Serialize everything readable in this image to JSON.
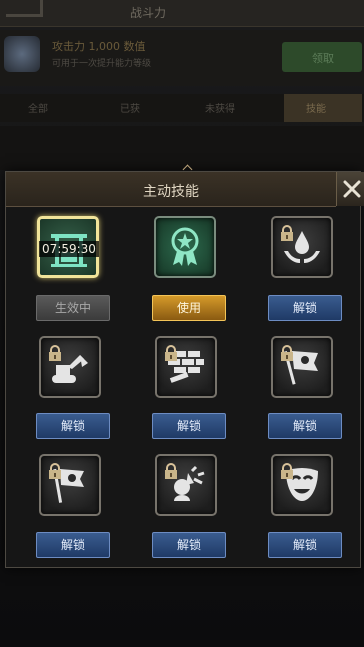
{
  "background": {
    "topbar_title": "战斗力",
    "item_title": "攻击力 1,000 数值",
    "item_sub": "可用于一次提升能力等级",
    "green_button": "领取",
    "tabs": [
      "全部",
      "已获",
      "未获得",
      "技能"
    ]
  },
  "dialog": {
    "title": "主动技能",
    "close": "close"
  },
  "skills": [
    {
      "icon": "harbor-crane-icon",
      "button": "生效中",
      "state": "active",
      "timer": "07:59:30"
    },
    {
      "icon": "award-ribbon-icon",
      "button": "使用",
      "state": "ready"
    },
    {
      "icon": "water-hands-icon",
      "button": "解锁",
      "state": "locked"
    },
    {
      "icon": "excavator-icon",
      "button": "解锁",
      "state": "locked"
    },
    {
      "icon": "brick-wall-icon",
      "button": "解锁",
      "state": "locked"
    },
    {
      "icon": "skull-flag-icon",
      "button": "解锁",
      "state": "locked"
    },
    {
      "icon": "bomb-flag-icon",
      "button": "解锁",
      "state": "locked"
    },
    {
      "icon": "impact-icon",
      "button": "解锁",
      "state": "locked"
    },
    {
      "icon": "theater-mask-icon",
      "button": "解锁",
      "state": "locked"
    }
  ],
  "colors": {
    "active_border": "#f1e49a",
    "use_button": "#d59a2a",
    "unlock_button": "#3a5c8f"
  }
}
